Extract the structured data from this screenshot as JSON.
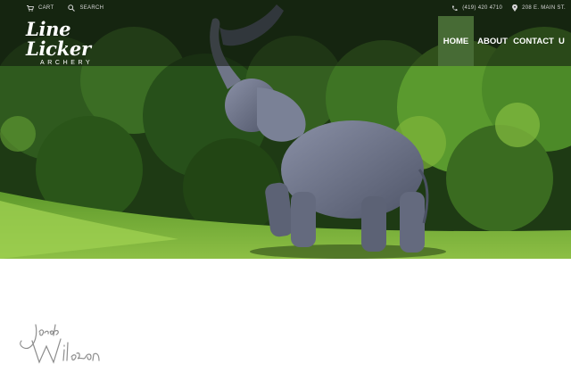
{
  "header": {
    "utility_left": [
      {
        "icon": "cart-icon",
        "label": "CART"
      },
      {
        "icon": "search-icon",
        "label": "SEARCH"
      }
    ],
    "phone": {
      "icon": "phone-icon",
      "label": "(419) 420 4710"
    },
    "address": {
      "icon": "location-pin-icon",
      "label": "208 E. MAIN ST."
    },
    "logo": {
      "main": "Line Licker",
      "sub": "ARCHERY"
    }
  },
  "nav": {
    "active_color": "#476b35",
    "items": [
      {
        "label": "HOME",
        "active": true
      },
      {
        "label": "ABOUT",
        "active": false
      },
      {
        "label": "CONTACT",
        "active": false
      },
      {
        "label": "U",
        "active": false
      }
    ]
  },
  "hero": {
    "image": "3D archery target elephant raising its trunk on a grassy field in front of trees"
  },
  "watermark": {
    "text": "Jacob Wilson"
  }
}
